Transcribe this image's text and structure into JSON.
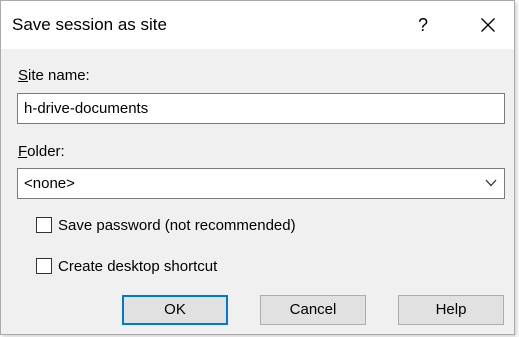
{
  "window": {
    "title": "Save session as site",
    "help_glyph": "?",
    "close_icon": "close-icon"
  },
  "site_name": {
    "label_accel": "S",
    "label_rest": "ite name:",
    "value": "h-drive-documents"
  },
  "folder": {
    "label_accel": "F",
    "label_rest": "older:",
    "selected": "<none>",
    "icon": "chevron-down-icon"
  },
  "options": {
    "save_password": {
      "label": "Save password (not recommended)",
      "checked": false
    },
    "desktop_shortcut": {
      "label": "Create desktop shortcut",
      "checked": false
    }
  },
  "buttons": {
    "ok": "OK",
    "cancel": "Cancel",
    "help": "Help"
  },
  "colors": {
    "dialog_bg": "#f0f0f0",
    "titlebar_bg": "#ffffff",
    "default_button_border": "#0078d7",
    "button_bg": "#e1e1e1"
  }
}
